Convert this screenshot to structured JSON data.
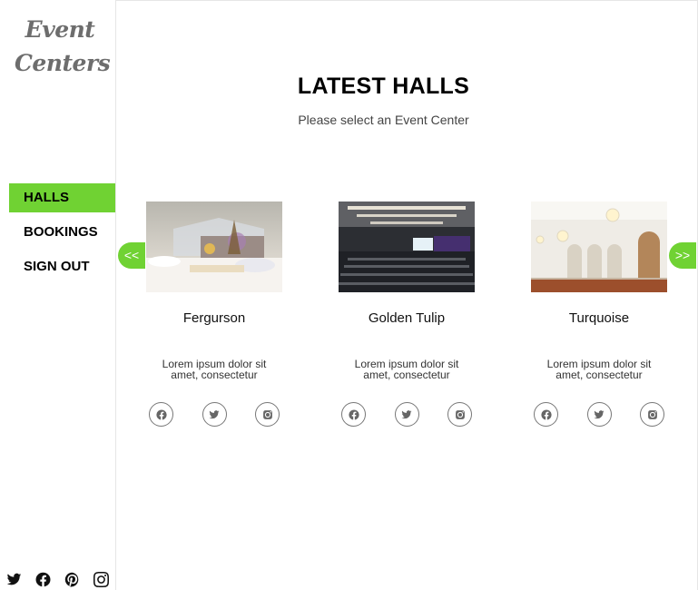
{
  "brand": {
    "line1": "Event",
    "line2": "Centers"
  },
  "nav": [
    {
      "label": "HALLS",
      "active": true
    },
    {
      "label": "BOOKINGS",
      "active": false
    },
    {
      "label": "SIGN OUT",
      "active": false
    }
  ],
  "header": {
    "title": "LATEST HALLS",
    "subtitle": "Please select an Event Center"
  },
  "carousel": {
    "prev_label": "<<",
    "next_label": ">>"
  },
  "halls": [
    {
      "name": "Fergurson",
      "description": "Lorem ipsum dolor sit amet, consectetur"
    },
    {
      "name": "Golden Tulip",
      "description": "Lorem ipsum dolor sit amet, consectetur"
    },
    {
      "name": "Turquoise",
      "description": "Lorem ipsum dolor sit amet, consectetur"
    }
  ],
  "card_icons": [
    "facebook-icon",
    "twitter-icon",
    "instagram-icon"
  ],
  "footer_icons": [
    "twitter-icon",
    "facebook-icon",
    "pinterest-icon",
    "instagram-icon"
  ],
  "colors": {
    "accent": "#70d233",
    "text": "#000000",
    "muted": "#6d6d6d"
  }
}
